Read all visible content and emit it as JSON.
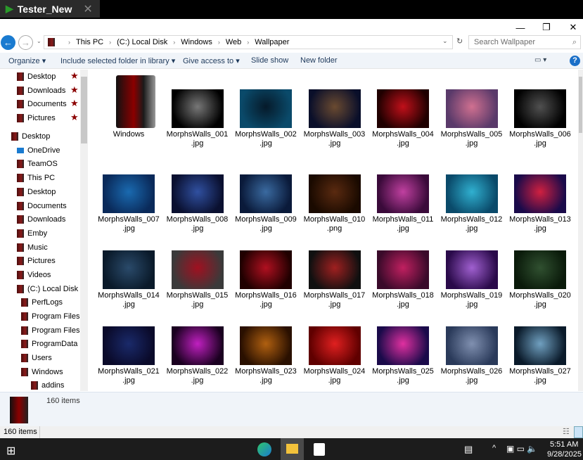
{
  "tab": {
    "title": "Tester_New"
  },
  "window": {
    "min": "—",
    "max": "❐",
    "close": "✕"
  },
  "breadcrumb": [
    "This PC",
    "(C:) Local Disk",
    "Windows",
    "Web",
    "Wallpaper"
  ],
  "search": {
    "placeholder": "Search Wallpaper"
  },
  "commands": {
    "organize": "Organize ▾",
    "include": "Include selected folder in library ▾",
    "share": "Give access to ▾",
    "slideshow": "Slide show",
    "newfolder": "New folder"
  },
  "sidebar": [
    {
      "label": "Desktop",
      "level": 1,
      "pinned": true
    },
    {
      "label": "Downloads",
      "level": 1,
      "pinned": true
    },
    {
      "label": "Documents",
      "level": 1,
      "pinned": true
    },
    {
      "label": "Pictures",
      "level": 1,
      "pinned": true
    },
    {
      "label": "Desktop",
      "level": 0
    },
    {
      "label": "OneDrive",
      "level": 1
    },
    {
      "label": "TeamOS",
      "level": 1
    },
    {
      "label": "This PC",
      "level": 1
    },
    {
      "label": "Desktop",
      "level": 2
    },
    {
      "label": "Documents",
      "level": 2
    },
    {
      "label": "Downloads",
      "level": 2
    },
    {
      "label": "Emby",
      "level": 2
    },
    {
      "label": "Music",
      "level": 2
    },
    {
      "label": "Pictures",
      "level": 2
    },
    {
      "label": "Videos",
      "level": 2
    },
    {
      "label": "(C:) Local Disk",
      "level": 2
    },
    {
      "label": "PerfLogs",
      "level": 3
    },
    {
      "label": "Program Files",
      "level": 3
    },
    {
      "label": "Program Files",
      "level": 3
    },
    {
      "label": "ProgramData",
      "level": 3
    },
    {
      "label": "Users",
      "level": 3
    },
    {
      "label": "Windows",
      "level": 3
    },
    {
      "label": "addins",
      "level": 4
    }
  ],
  "files": [
    {
      "name": "Windows",
      "ext": "",
      "colors": [
        "#000000",
        "#000000"
      ],
      "folder": true
    },
    {
      "name": "MorphsWalls_001",
      ".": "",
      "ext": ".jpg",
      "colors": [
        "#000000",
        "#777777"
      ]
    },
    {
      "name": "MorphsWalls_002",
      "ext": ".jpg",
      "colors": [
        "#0a4a6a",
        "#061a2a"
      ]
    },
    {
      "name": "MorphsWalls_003",
      "ext": ".jpg",
      "colors": [
        "#0a0f2a",
        "#6a4a30"
      ]
    },
    {
      "name": "MorphsWalls_004",
      "ext": ".jpg",
      "colors": [
        "#200000",
        "#c0101a"
      ]
    },
    {
      "name": "MorphsWalls_005",
      "ext": ".jpg",
      "colors": [
        "#5a3a6a",
        "#d07090"
      ]
    },
    {
      "name": "MorphsWalls_006",
      "ext": ".jpg",
      "colors": [
        "#000000",
        "#505050"
      ]
    },
    {
      "name": "MorphsWalls_007",
      "ext": ".jpg",
      "colors": [
        "#0a2a5a",
        "#1a6ab0"
      ]
    },
    {
      "name": "MorphsWalls_008",
      "ext": ".jpg",
      "colors": [
        "#0a1030",
        "#3050a0"
      ]
    },
    {
      "name": "MorphsWalls_009",
      "ext": ".jpg",
      "colors": [
        "#0a1a3a",
        "#3a6aa0"
      ]
    },
    {
      "name": "MorphsWalls_010",
      "ext": ".png",
      "colors": [
        "#1a0a00",
        "#5a2a10"
      ]
    },
    {
      "name": "MorphsWalls_011",
      "ext": ".jpg",
      "colors": [
        "#3a0a3a",
        "#c040a0"
      ]
    },
    {
      "name": "MorphsWalls_012",
      "ext": ".jpg",
      "colors": [
        "#0a4a6a",
        "#30b0d0"
      ]
    },
    {
      "name": "MorphsWalls_013",
      "ext": ".jpg",
      "colors": [
        "#1a0a4a",
        "#d02040"
      ]
    },
    {
      "name": "MorphsWalls_014",
      "ext": ".jpg",
      "colors": [
        "#0a1a2a",
        "#2a4a6a"
      ]
    },
    {
      "name": "MorphsWalls_015",
      "ext": ".jpg",
      "colors": [
        "#3a3a3a",
        "#a01020"
      ]
    },
    {
      "name": "MorphsWalls_016",
      "ext": ".jpg",
      "colors": [
        "#200000",
        "#b01020"
      ]
    },
    {
      "name": "MorphsWalls_017",
      "ext": ".jpg",
      "colors": [
        "#101010",
        "#a02020"
      ]
    },
    {
      "name": "MorphsWalls_018",
      "ext": ".jpg",
      "colors": [
        "#3a0a2a",
        "#c02060"
      ]
    },
    {
      "name": "MorphsWalls_019",
      "ext": ".jpg",
      "colors": [
        "#2a0a4a",
        "#a060d0"
      ]
    },
    {
      "name": "MorphsWalls_020",
      "ext": ".jpg",
      "colors": [
        "#0a1a0a",
        "#305030"
      ]
    },
    {
      "name": "MorphsWalls_021",
      "ext": ".jpg",
      "colors": [
        "#0a0a2a",
        "#1a2a6a"
      ]
    },
    {
      "name": "MorphsWalls_022",
      "ext": ".jpg",
      "colors": [
        "#1a0020",
        "#c020c0"
      ]
    },
    {
      "name": "MorphsWalls_023",
      "ext": ".jpg",
      "colors": [
        "#2a1000",
        "#b06010"
      ]
    },
    {
      "name": "MorphsWalls_024",
      "ext": ".jpg",
      "colors": [
        "#600000",
        "#e02020"
      ]
    },
    {
      "name": "MorphsWalls_025",
      "ext": ".jpg",
      "colors": [
        "#1a0a4a",
        "#e030a0"
      ]
    },
    {
      "name": "MorphsWalls_026",
      "ext": ".jpg",
      "colors": [
        "#2a3a5a",
        "#8090b0"
      ]
    },
    {
      "name": "MorphsWalls_027",
      "ext": ".jpg",
      "colors": [
        "#0a1a2a",
        "#70a0c0"
      ]
    }
  ],
  "details": {
    "count": "160 items"
  },
  "status": {
    "count": "160 items"
  },
  "taskbar": {
    "time": "5:51 AM",
    "date": "9/28/2025"
  }
}
